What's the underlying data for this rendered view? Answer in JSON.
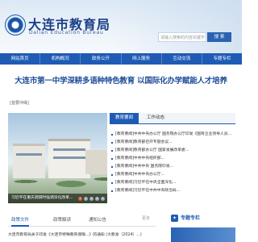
{
  "header": {
    "site_title": "大连市教育局",
    "site_subtitle": "Dalian Education Bureau",
    "search_placeholder": "请输入搜索的内容关键字",
    "search_button": "搜 索"
  },
  "nav": {
    "items": [
      "网站首页",
      "机构概况",
      "政务公开",
      "网上服务",
      "互动交流",
      "专题专栏"
    ]
  },
  "article": {
    "title": "大连市第一中学深耕多语种特色教育 以国际化办学赋能人才培养",
    "tag": "[首要冲绳]"
  },
  "slideshow": {
    "caption": "习近平在重庆调研时强调深化改革...",
    "dots": [
      "1",
      "2",
      "3",
      "4",
      "5"
    ]
  },
  "news": {
    "tabs": [
      "教育要闻",
      "工作动态"
    ],
    "items": [
      "[教育要闻]中共中央办公厅 国务院办公厅印发《国有企业领导人员...",
      "[教育要闻]教育部召开专题会议...",
      "[教育要闻]教育部办公厅 国家发展改革委...",
      "[教育要闻]中共中央组织部...",
      "[教育要闻]中共中央 国务院印发...",
      "[教育要闻]中共中央办公厅...",
      "[教育要闻]习近平在中央全面深化...",
      "[教育要闻]习近平在中共中央政治局..."
    ]
  },
  "policy": {
    "tabs": [
      "政策文件",
      "政策解读",
      "通知公告"
    ],
    "more": "更多",
    "first_item": "大连市教育局关于印发《大连市特殊教育保障...》的通知 (大教发〔2024〕...)"
  },
  "special": {
    "label": "专题专栏"
  },
  "colors": {
    "brand": "#1f5bb5",
    "title": "#1f4d99"
  }
}
